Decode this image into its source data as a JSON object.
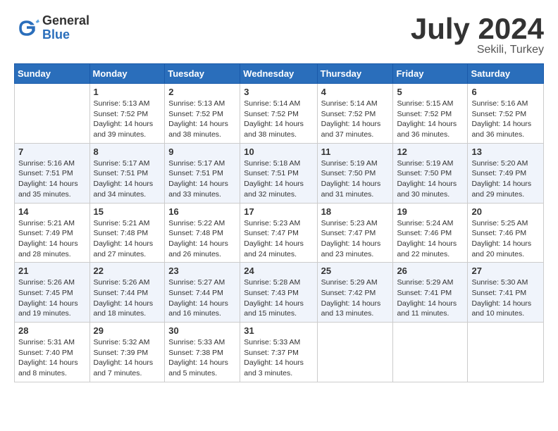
{
  "header": {
    "logo": {
      "general": "General",
      "blue": "Blue"
    },
    "title": "July 2024",
    "location": "Sekili, Turkey"
  },
  "calendar": {
    "columns": [
      "Sunday",
      "Monday",
      "Tuesday",
      "Wednesday",
      "Thursday",
      "Friday",
      "Saturday"
    ],
    "weeks": [
      [
        {
          "day": "",
          "info": ""
        },
        {
          "day": "1",
          "info": "Sunrise: 5:13 AM\nSunset: 7:52 PM\nDaylight: 14 hours\nand 39 minutes."
        },
        {
          "day": "2",
          "info": "Sunrise: 5:13 AM\nSunset: 7:52 PM\nDaylight: 14 hours\nand 38 minutes."
        },
        {
          "day": "3",
          "info": "Sunrise: 5:14 AM\nSunset: 7:52 PM\nDaylight: 14 hours\nand 38 minutes."
        },
        {
          "day": "4",
          "info": "Sunrise: 5:14 AM\nSunset: 7:52 PM\nDaylight: 14 hours\nand 37 minutes."
        },
        {
          "day": "5",
          "info": "Sunrise: 5:15 AM\nSunset: 7:52 PM\nDaylight: 14 hours\nand 36 minutes."
        },
        {
          "day": "6",
          "info": "Sunrise: 5:16 AM\nSunset: 7:52 PM\nDaylight: 14 hours\nand 36 minutes."
        }
      ],
      [
        {
          "day": "7",
          "info": "Sunrise: 5:16 AM\nSunset: 7:51 PM\nDaylight: 14 hours\nand 35 minutes."
        },
        {
          "day": "8",
          "info": "Sunrise: 5:17 AM\nSunset: 7:51 PM\nDaylight: 14 hours\nand 34 minutes."
        },
        {
          "day": "9",
          "info": "Sunrise: 5:17 AM\nSunset: 7:51 PM\nDaylight: 14 hours\nand 33 minutes."
        },
        {
          "day": "10",
          "info": "Sunrise: 5:18 AM\nSunset: 7:51 PM\nDaylight: 14 hours\nand 32 minutes."
        },
        {
          "day": "11",
          "info": "Sunrise: 5:19 AM\nSunset: 7:50 PM\nDaylight: 14 hours\nand 31 minutes."
        },
        {
          "day": "12",
          "info": "Sunrise: 5:19 AM\nSunset: 7:50 PM\nDaylight: 14 hours\nand 30 minutes."
        },
        {
          "day": "13",
          "info": "Sunrise: 5:20 AM\nSunset: 7:49 PM\nDaylight: 14 hours\nand 29 minutes."
        }
      ],
      [
        {
          "day": "14",
          "info": "Sunrise: 5:21 AM\nSunset: 7:49 PM\nDaylight: 14 hours\nand 28 minutes."
        },
        {
          "day": "15",
          "info": "Sunrise: 5:21 AM\nSunset: 7:48 PM\nDaylight: 14 hours\nand 27 minutes."
        },
        {
          "day": "16",
          "info": "Sunrise: 5:22 AM\nSunset: 7:48 PM\nDaylight: 14 hours\nand 26 minutes."
        },
        {
          "day": "17",
          "info": "Sunrise: 5:23 AM\nSunset: 7:47 PM\nDaylight: 14 hours\nand 24 minutes."
        },
        {
          "day": "18",
          "info": "Sunrise: 5:23 AM\nSunset: 7:47 PM\nDaylight: 14 hours\nand 23 minutes."
        },
        {
          "day": "19",
          "info": "Sunrise: 5:24 AM\nSunset: 7:46 PM\nDaylight: 14 hours\nand 22 minutes."
        },
        {
          "day": "20",
          "info": "Sunrise: 5:25 AM\nSunset: 7:46 PM\nDaylight: 14 hours\nand 20 minutes."
        }
      ],
      [
        {
          "day": "21",
          "info": "Sunrise: 5:26 AM\nSunset: 7:45 PM\nDaylight: 14 hours\nand 19 minutes."
        },
        {
          "day": "22",
          "info": "Sunrise: 5:26 AM\nSunset: 7:44 PM\nDaylight: 14 hours\nand 18 minutes."
        },
        {
          "day": "23",
          "info": "Sunrise: 5:27 AM\nSunset: 7:44 PM\nDaylight: 14 hours\nand 16 minutes."
        },
        {
          "day": "24",
          "info": "Sunrise: 5:28 AM\nSunset: 7:43 PM\nDaylight: 14 hours\nand 15 minutes."
        },
        {
          "day": "25",
          "info": "Sunrise: 5:29 AM\nSunset: 7:42 PM\nDaylight: 14 hours\nand 13 minutes."
        },
        {
          "day": "26",
          "info": "Sunrise: 5:29 AM\nSunset: 7:41 PM\nDaylight: 14 hours\nand 11 minutes."
        },
        {
          "day": "27",
          "info": "Sunrise: 5:30 AM\nSunset: 7:41 PM\nDaylight: 14 hours\nand 10 minutes."
        }
      ],
      [
        {
          "day": "28",
          "info": "Sunrise: 5:31 AM\nSunset: 7:40 PM\nDaylight: 14 hours\nand 8 minutes."
        },
        {
          "day": "29",
          "info": "Sunrise: 5:32 AM\nSunset: 7:39 PM\nDaylight: 14 hours\nand 7 minutes."
        },
        {
          "day": "30",
          "info": "Sunrise: 5:33 AM\nSunset: 7:38 PM\nDaylight: 14 hours\nand 5 minutes."
        },
        {
          "day": "31",
          "info": "Sunrise: 5:33 AM\nSunset: 7:37 PM\nDaylight: 14 hours\nand 3 minutes."
        },
        {
          "day": "",
          "info": ""
        },
        {
          "day": "",
          "info": ""
        },
        {
          "day": "",
          "info": ""
        }
      ]
    ]
  }
}
